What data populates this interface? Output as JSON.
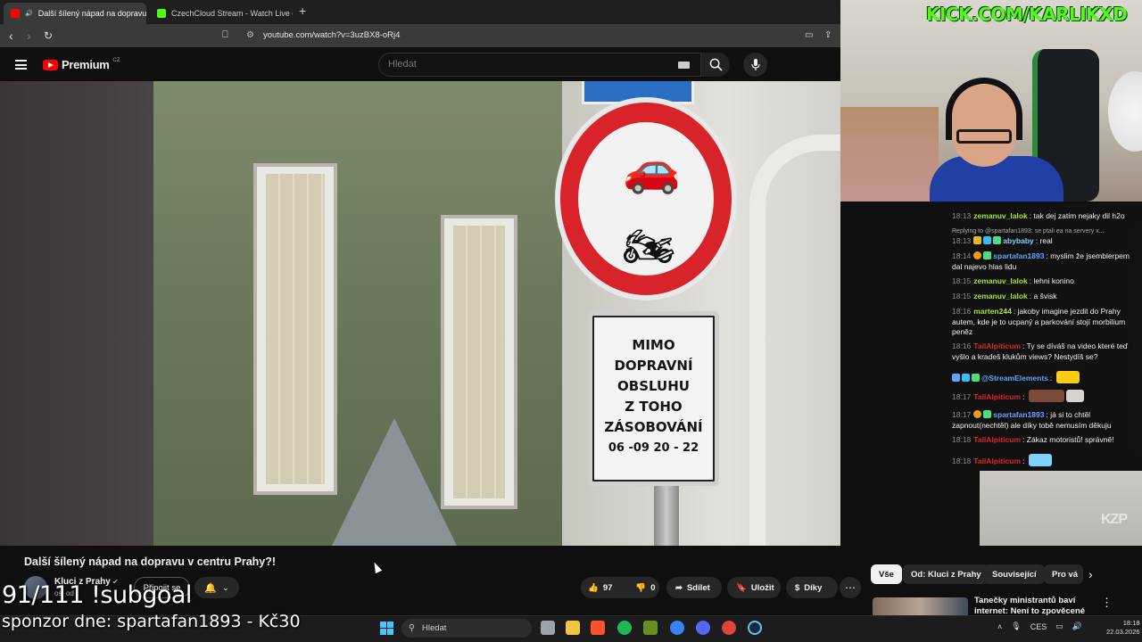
{
  "browser": {
    "tabs": [
      {
        "title": "Další šílený nápad na dopravu",
        "active": true,
        "favicon_color": "#ff0000"
      },
      {
        "title": "CzechCloud Stream - Watch Live on",
        "active": false,
        "favicon_color": "#53fc18"
      }
    ],
    "url": "youtube.com/watch?v=3uzBX8-oRj4",
    "icons": [
      "back-icon",
      "forward-icon",
      "reload-icon",
      "bookmark-icon",
      "site-info-icon",
      "cast-icon",
      "share-icon"
    ]
  },
  "youtube": {
    "logo_text": "Premium",
    "country_code": "CZ",
    "search_placeholder": "Hledat"
  },
  "video": {
    "sign_lines": [
      "MIMO",
      "DOPRAVNÍ",
      "OBSLUHU",
      "Z TOHO",
      "ZÁSOBOVÁNÍ",
      "06 -09  20 - 22"
    ],
    "watermark": "KZP",
    "title": "Další šílený nápad na dopravu v centru Prahy?!",
    "channel": "Kluci z Prahy",
    "subscribers": "os. od",
    "join_label": "Připojit se",
    "likes": "97",
    "dislikes": "0",
    "share_label": "Sdílet",
    "save_label": "Uložit",
    "thanks_label": "Díky",
    "more_label": "⋯"
  },
  "chips": [
    "Vše",
    "Od: Kluci z Prahy",
    "Související",
    "Pro vá"
  ],
  "recommended": {
    "title": "Tanečky ministrantů baví internet: Není to zpověcené"
  },
  "overlay": {
    "kick_text": "KICK.COM/KARLIKXD",
    "subgoal": "91/111 !subgoal",
    "sponsor": "sponzor dne: spartafan1893 - Kč30"
  },
  "chat": [
    {
      "time": "18:13",
      "user": "zemanuv_lalok",
      "color": "#a3e635",
      "text": "tak dej zatim nejaky dil h2o"
    },
    {
      "reply": "Replying to @spartafan1893: se ptali ea na servery x..."
    },
    {
      "time": "18:13",
      "user": "abybaby",
      "color": "#7dd3fc",
      "text": "real",
      "badges": [
        "#e8b923",
        "#38bdf8",
        "#4ade80"
      ]
    },
    {
      "time": "18:14",
      "user": "spartafan1893",
      "color": "#60a5fa",
      "text": "myslim že jsemblerpem dal najevo hlas lidu",
      "badges": [
        "#f59e0b",
        "#4ade80"
      ]
    },
    {
      "time": "18:15",
      "user": "zemanuv_lalok",
      "color": "#a3e635",
      "text": "lehni konino"
    },
    {
      "time": "18:15",
      "user": "zemanuv_lalok",
      "color": "#a3e635",
      "text": "a švisk"
    },
    {
      "time": "18:16",
      "user": "marten244",
      "color": "#a3e635",
      "text": "jakoby imagine jezdit do Prahy autem, kde je to ucpaný a parkování stojí morbilium peněz"
    },
    {
      "time": "18:16",
      "user": "TailAlpiticum",
      "color": "#dc2626",
      "text": "Ty se díváš na video které teď vyšlo a kradeš klukům views? Nestydíš se?"
    },
    {
      "time": "",
      "user": "@StreamElements",
      "color": "#60a5fa",
      "text": ""
    },
    {
      "time": "18:17",
      "user": "TailAlpiticum",
      "color": "#dc2626",
      "text": ""
    },
    {
      "time": "18:17",
      "user": "spartafan1893",
      "color": "#60a5fa",
      "text": "já si to chtěl zapnout(nechtěl) ale díky tobě nemusím děkuju",
      "badges": [
        "#f59e0b",
        "#4ade80"
      ]
    },
    {
      "time": "18:18",
      "user": "TailAlpiticum",
      "color": "#dc2626",
      "text": "Zákaz motoristů! správně!"
    },
    {
      "time": "18:18",
      "user": "TailAlpiticum",
      "color": "#dc2626",
      "text": ""
    }
  ],
  "taskbar": {
    "search_placeholder": "Hledat",
    "language": "CES",
    "time": "18:18",
    "date": "22.03.2026",
    "icons": [
      {
        "name": "task-view-icon",
        "color": "#9ca3af"
      },
      {
        "name": "file-explorer-icon",
        "color": "#f5c542"
      },
      {
        "name": "brave-icon",
        "color": "#fb542b"
      },
      {
        "name": "spotify-icon",
        "color": "#1db954"
      },
      {
        "name": "notepad-icon",
        "color": "#6b8e23"
      },
      {
        "name": "ccleaner-icon",
        "color": "#3b82f6"
      },
      {
        "name": "discord-icon",
        "color": "#5865f2"
      },
      {
        "name": "chrome-icon",
        "color": "#db4437"
      },
      {
        "name": "steam-icon",
        "color": "#1b2838"
      }
    ]
  }
}
